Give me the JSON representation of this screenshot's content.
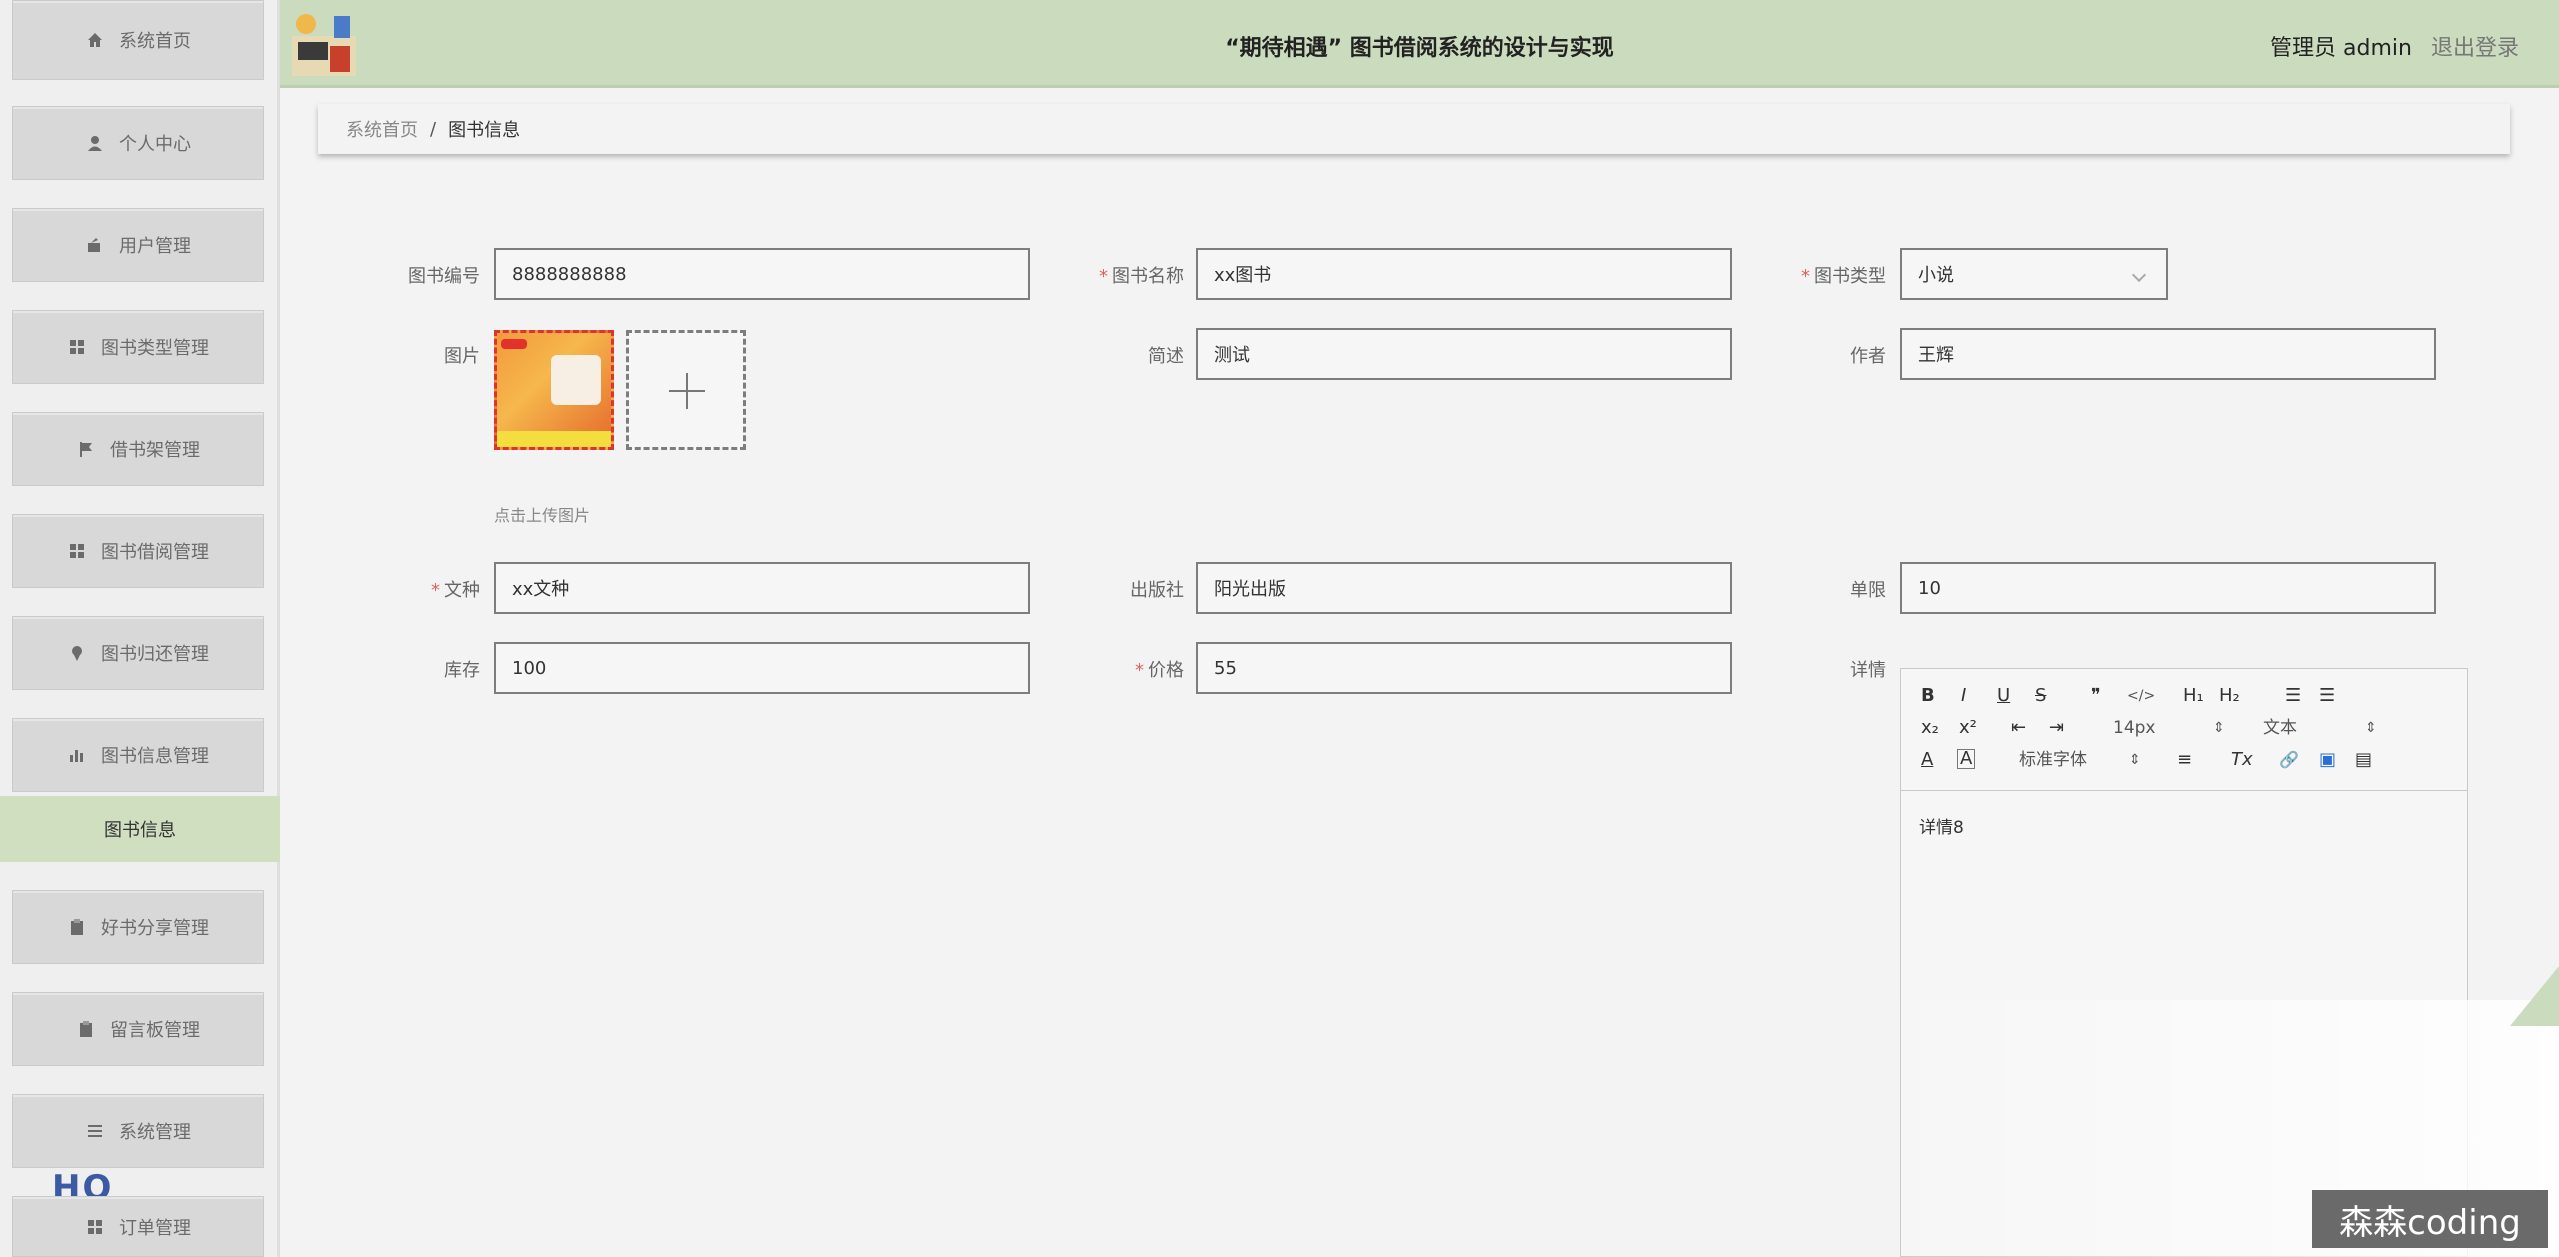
{
  "header": {
    "title": "“期待相遇” 图书借阅系统的设计与实现",
    "user_label": "管理员 admin",
    "logout_label": "退出登录"
  },
  "sidebar": {
    "items": [
      {
        "label": "系统首页",
        "icon": "home-icon"
      },
      {
        "label": "个人中心",
        "icon": "user-icon"
      },
      {
        "label": "用户管理",
        "icon": "user-manage-icon"
      },
      {
        "label": "图书类型管理",
        "icon": "grid-icon"
      },
      {
        "label": "借书架管理",
        "icon": "flag-icon"
      },
      {
        "label": "图书借阅管理",
        "icon": "grid-icon"
      },
      {
        "label": "图书归还管理",
        "icon": "pin-icon"
      },
      {
        "label": "图书信息管理",
        "icon": "bar-chart-icon"
      }
    ],
    "active_sub": "图书信息",
    "items_after": [
      {
        "label": "好书分享管理",
        "icon": "clipboard-icon"
      },
      {
        "label": "留言板管理",
        "icon": "clipboard-icon"
      },
      {
        "label": "系统管理",
        "icon": "list-icon"
      },
      {
        "label": "订单管理",
        "icon": "grid-icon"
      }
    ],
    "logo_text": "HO"
  },
  "breadcrumb": {
    "home": "系统首页",
    "separator": "/",
    "current": "图书信息"
  },
  "form": {
    "book_no_label": "图书编号",
    "book_no": "8888888888",
    "book_name_label": "图书名称",
    "book_name": "xx图书",
    "book_type_label": "图书类型",
    "book_type": "小说",
    "image_label": "图片",
    "upload_hint": "点击上传图片",
    "desc_label": "简述",
    "desc": "测试",
    "author_label": "作者",
    "author": "王辉",
    "language_label": "文种",
    "language": "xx文种",
    "publisher_label": "出版社",
    "publisher": "阳光出版",
    "limit_label": "单限",
    "limit": "10",
    "stock_label": "库存",
    "stock": "100",
    "price_label": "价格",
    "price": "55",
    "detail_label": "详情",
    "required_mark": "*"
  },
  "editor": {
    "bold": "B",
    "italic": "I",
    "underline": "U",
    "strike": "S",
    "quote": "❞",
    "code": "</>",
    "h1": "H₁",
    "h2": "H₂",
    "ol": "☰",
    "ul": "☰",
    "sub": "x₂",
    "sup": "x²",
    "outdent": "⇤",
    "indent": "⇥",
    "size": "14px",
    "size_arrow": "⇕",
    "format": "文本",
    "format_arrow": "⇕",
    "color": "A",
    "bg": "A",
    "font": "标准字体",
    "font_arrow": "⇕",
    "align": "≡",
    "clear": "Tx",
    "link": "🔗",
    "image": "▣",
    "video": "▤",
    "content": "详情8"
  },
  "watermark": "森森coding"
}
